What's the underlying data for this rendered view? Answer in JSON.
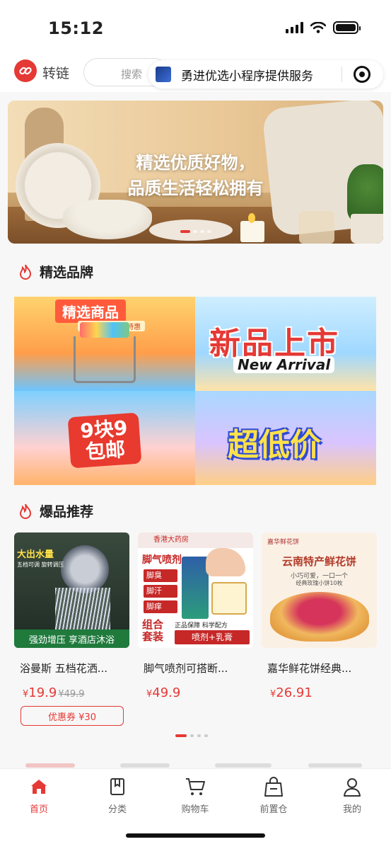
{
  "status": {
    "time": "15:12"
  },
  "header": {
    "app_name": "转链",
    "search_placeholder": "搜索",
    "capsule_text": "勇进优选小程序提供服务"
  },
  "banner": {
    "line1": "精选优质好物，",
    "line2": "品质生活轻松拥有"
  },
  "brands": {
    "title": "精选品牌",
    "tiles": [
      {
        "label": "精选商品",
        "sub": "品质优选 限时特惠"
      },
      {
        "label": "新品上市",
        "sub": "New Arrival"
      },
      {
        "label": "9块9包邮"
      },
      {
        "label": "超低价"
      }
    ]
  },
  "hot": {
    "title": "爆品推荐",
    "products": [
      {
        "name": "浴曼斯 五档花洒...",
        "currency": "¥",
        "price": "19.9",
        "old_price": "¥49.9",
        "coupon": "优惠券 ¥30",
        "img_tag": "大出水量",
        "img_tag2": "五档可调 旋转调压",
        "img_bar": "强劲增压 享酒店沐浴"
      },
      {
        "name": "脚气喷剂可搭断...",
        "currency": "¥",
        "price": "49.9",
        "img_top": "香港大药房",
        "img_title": "脚气喷剂",
        "img_items": [
          "脚臭",
          "脚汗",
          "脚痒"
        ],
        "img_big": "组合套装",
        "img_sub1": "正品保障 科学配方",
        "img_sub2": "喷剂+乳膏"
      },
      {
        "name": "嘉华鲜花饼经典...",
        "currency": "¥",
        "price": "26.91",
        "img_brand": "嘉华鲜花饼",
        "img_title": "云南特产鲜花饼",
        "img_s1": "小巧可爱，一口一个",
        "img_s2": "经典玫瑰小饼10枚"
      }
    ]
  },
  "tabs": [
    {
      "label": "首页",
      "icon": "home-icon",
      "active": true
    },
    {
      "label": "分类",
      "icon": "category-icon"
    },
    {
      "label": "购物车",
      "icon": "cart-icon"
    },
    {
      "label": "前置仓",
      "icon": "warehouse-bag-icon"
    },
    {
      "label": "我的",
      "icon": "user-icon"
    }
  ],
  "colors": {
    "accent": "#e53935"
  }
}
